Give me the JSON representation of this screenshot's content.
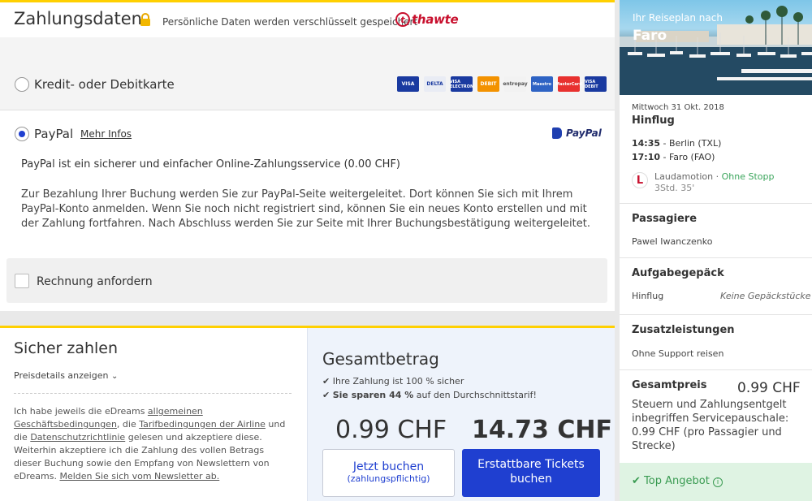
{
  "payment": {
    "title": "Zahlungsdaten",
    "secure_note": "Persönliche Daten werden verschlüsselt gespeichert",
    "thawte": "thawte",
    "card_option": "Kredit- oder Debitkarte",
    "card_logos": [
      "VISA",
      "DELTA",
      "VISA ELECTRON",
      "DEBIT",
      "entropay",
      "Maestro",
      "MasterCard",
      "VISA DEBIT"
    ],
    "paypal_option": "PayPal",
    "paypal_more": "Mehr Infos",
    "paypal_logo": "PayPal",
    "paypal_title": "PayPal ist ein sicherer und einfacher Online-Zahlungsservice (0.00 CHF)",
    "paypal_desc": "Zur Bezahlung Ihrer Buchung werden Sie zur PayPal-Seite weitergeleitet. Dort können Sie sich mit Ihrem PayPal-Konto anmelden. Wenn Sie noch nicht registriert sind, können Sie ein neues Konto erstellen und mit der Zahlung fortfahren. Nach Abschluss werden Sie zur Seite mit Ihrer Buchungsbestätigung weitergeleitet.",
    "invoice_label": "Rechnung anfordern"
  },
  "secure": {
    "title": "Sicher zahlen",
    "price_details": "Preisdetails anzeigen",
    "legal": {
      "p1": "Ich habe jeweils die eDreams ",
      "link1": "allgemeinen Geschäftsbedingungen",
      "p2": ", die ",
      "link2": "Tarifbedingungen der Airline",
      "p3": " und die ",
      "link3": "Datenschutzrichtlinie",
      "p4": " gelesen und akzeptiere diese. Weiterhin akzeptiere ich die Zahlung des vollen Betrags dieser Buchung sowie den Empfang von Newslettern von eDreams. ",
      "link4": "Melden Sie sich vom Newsletter ab."
    }
  },
  "total": {
    "title": "Gesamtbetrag",
    "feature1": "Ihre Zahlung ist 100 % sicher",
    "feature2_bold": "Sie sparen 44 %",
    "feature2_rest": " auf den Durchschnittstarif!",
    "price_small": "0.99 CHF",
    "price_big": "14.73 CHF",
    "book_label": "Jetzt buchen",
    "book_sub": "(zahlungspflichtig)",
    "refund_label": "Erstattbare Tickets buchen"
  },
  "sidebar": {
    "trip_label": "Ihr Reiseplan nach",
    "trip_city": "Faro",
    "flight_date": "Mittwoch 31 Okt. 2018",
    "flight_direction": "Hinflug",
    "departure_time": "14:35",
    "departure_place": "Berlin (TXL)",
    "arrival_time": "17:10",
    "arrival_place": "Faro (FAO)",
    "airline": "Laudamotion",
    "stops": "Ohne Stopp",
    "duration": "3Std. 35'",
    "passengers_title": "Passagiere",
    "passenger_name": "Pawel Iwanczenko",
    "baggage_title": "Aufgabegepäck",
    "baggage_leg": "Hinflug",
    "baggage_value": "Keine Gepäckstücke",
    "extras_title": "Zusatzleistungen",
    "extras_value": "Ohne Support reisen",
    "total_title": "Gesamtpreis",
    "total_price": "0.99 CHF",
    "fees_text": "Steuern und Zahlungsentgelt inbegriffen Servicepauschale: 0.99 CHF (pro Passagier und Strecke)",
    "top_offer": "Top Angebot"
  },
  "colors": {
    "accent_yellow": "#ffd000",
    "brand_blue": "#1f3fd0",
    "green": "#3aa55b"
  }
}
